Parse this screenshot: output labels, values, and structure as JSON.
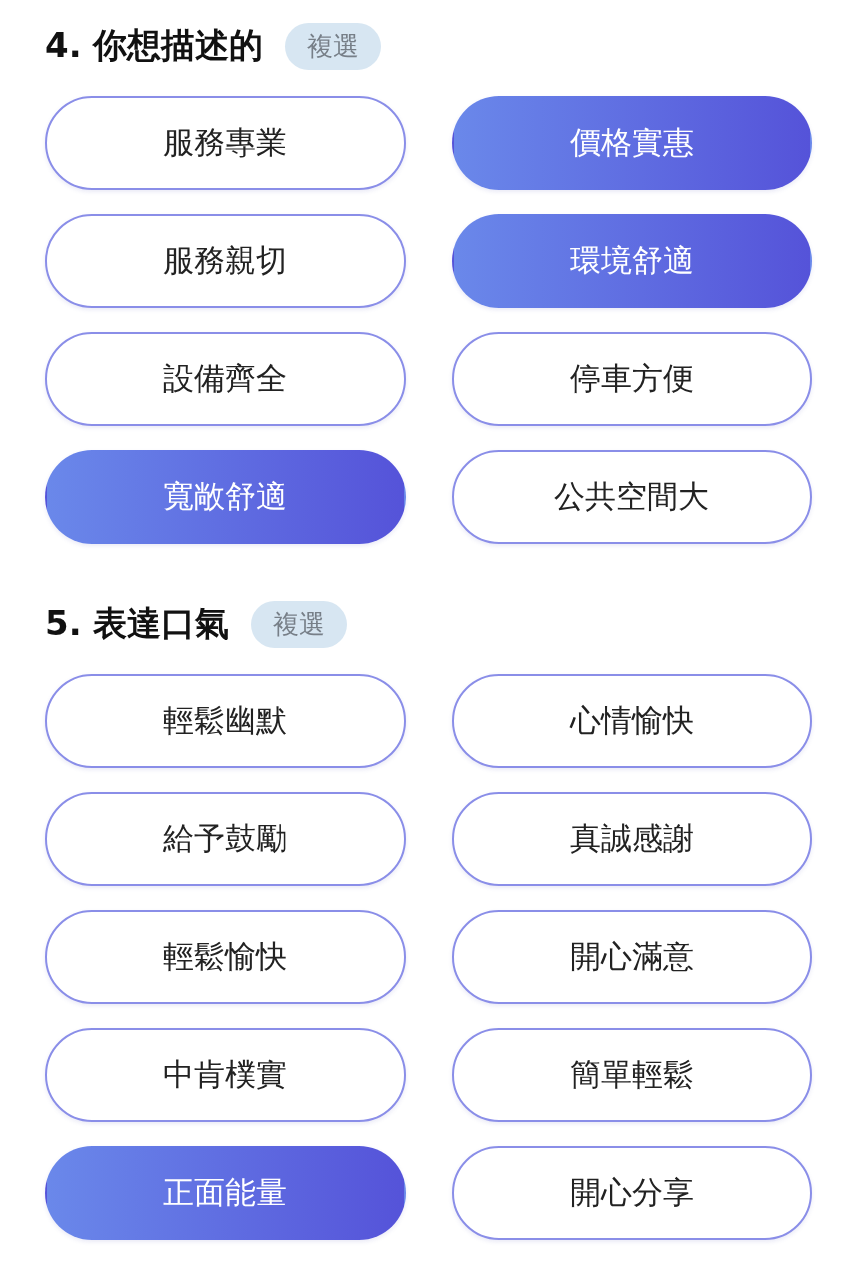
{
  "sections": [
    {
      "title": "4. 你想描述的",
      "badge": "複選",
      "options": [
        {
          "label": "服務專業",
          "selected": false
        },
        {
          "label": "價格實惠",
          "selected": true
        },
        {
          "label": "服務親切",
          "selected": false
        },
        {
          "label": "環境舒適",
          "selected": true
        },
        {
          "label": "設備齊全",
          "selected": false
        },
        {
          "label": "停車方便",
          "selected": false
        },
        {
          "label": "寬敞舒適",
          "selected": true
        },
        {
          "label": "公共空間大",
          "selected": false
        }
      ]
    },
    {
      "title": "5. 表達口氣",
      "badge": "複選",
      "options": [
        {
          "label": "輕鬆幽默",
          "selected": false
        },
        {
          "label": "心情愉快",
          "selected": false
        },
        {
          "label": "給予鼓勵",
          "selected": false
        },
        {
          "label": "真誠感謝",
          "selected": false
        },
        {
          "label": "輕鬆愉快",
          "selected": false
        },
        {
          "label": "開心滿意",
          "selected": false
        },
        {
          "label": "中肯樸實",
          "selected": false
        },
        {
          "label": "簡單輕鬆",
          "selected": false
        },
        {
          "label": "正面能量",
          "selected": true
        },
        {
          "label": "開心分享",
          "selected": false
        }
      ]
    }
  ]
}
